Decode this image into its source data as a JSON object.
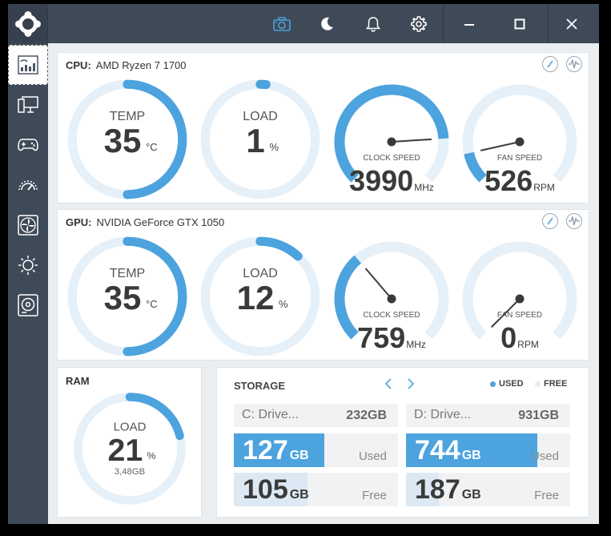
{
  "cpu": {
    "label": "CPU:",
    "name": "AMD Ryzen 7 1700",
    "temp": {
      "label": "TEMP",
      "value": 35,
      "unit": "°C",
      "fraction": 0.5
    },
    "load": {
      "label": "LOAD",
      "value": 1,
      "unit": "%",
      "fraction": 0.01
    },
    "clock": {
      "label": "CLOCK SPEED",
      "value": 3990,
      "unit": "MHz",
      "fraction": 0.82
    },
    "fan": {
      "label": "FAN SPEED",
      "value": 526,
      "unit": "RPM",
      "fraction": 0.12
    }
  },
  "gpu": {
    "label": "GPU:",
    "name": "NVIDIA GeForce GTX 1050",
    "temp": {
      "label": "TEMP",
      "value": 35,
      "unit": "°C",
      "fraction": 0.5
    },
    "load": {
      "label": "LOAD",
      "value": 12,
      "unit": "%",
      "fraction": 0.12
    },
    "clock": {
      "label": "CLOCK SPEED",
      "value": 759,
      "unit": "MHz",
      "fraction": 0.35
    },
    "fan": {
      "label": "FAN SPEED",
      "value": 0,
      "unit": "RPM",
      "fraction": 0.0
    }
  },
  "ram": {
    "title": "RAM",
    "load": {
      "label": "LOAD",
      "value": 21,
      "unit": "%",
      "fraction": 0.21,
      "amount": "3,48GB"
    }
  },
  "storage": {
    "title": "STORAGE",
    "legend_used": "USED",
    "legend_free": "FREE",
    "drives": [
      {
        "name": "C: Drive...",
        "size": "232GB",
        "used": "127",
        "used_unit": "GB",
        "used_label": "Used",
        "free": "105",
        "free_unit": "GB",
        "free_label": "Free",
        "used_fraction": 0.55,
        "free_fraction": 0.45
      },
      {
        "name": "D: Drive...",
        "size": "931GB",
        "used": "744",
        "used_unit": "GB",
        "used_label": "Used",
        "free": "187",
        "free_unit": "GB",
        "free_label": "Free",
        "used_fraction": 0.8,
        "free_fraction": 0.2
      }
    ]
  },
  "colors": {
    "accent": "#4ca3dd",
    "track": "#e6f0f8",
    "needle": "#3a3a3a",
    "sidebar": "#3f4a58",
    "free_fill": "#dce9f4"
  },
  "icons": {
    "logo": "app-logo-icon",
    "screenshot": "camera-icon",
    "theme": "moon-icon",
    "notifications": "bell-icon",
    "settings": "gear-icon"
  }
}
